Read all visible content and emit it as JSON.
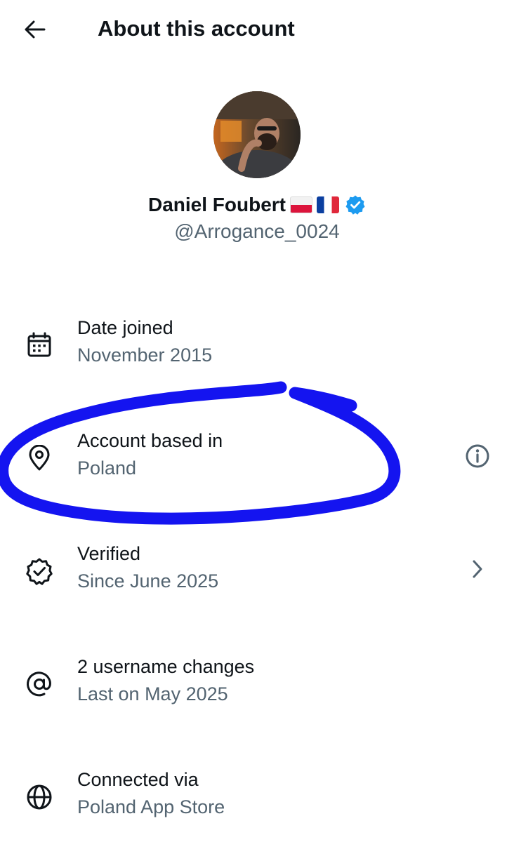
{
  "header": {
    "title": "About this account",
    "back_icon": "arrow-left-icon"
  },
  "profile": {
    "display_name": "Daniel Foubert",
    "flags": [
      "poland-flag",
      "france-flag"
    ],
    "verified_badge_color": "#1d9bf0",
    "handle": "@Arrogance_0024"
  },
  "rows": [
    {
      "icon": "calendar-icon",
      "label": "Date joined",
      "value": "November 2015",
      "action": null
    },
    {
      "icon": "location-pin-icon",
      "label": "Account based in",
      "value": "Poland",
      "action": "info-icon"
    },
    {
      "icon": "verified-check-icon",
      "label": "Verified",
      "value": "Since June 2025",
      "action": "chevron-right-icon"
    },
    {
      "icon": "at-sign-icon",
      "label": "2 username changes",
      "value": "Last on May 2025",
      "action": null
    },
    {
      "icon": "globe-icon",
      "label": "Connected via",
      "value": "Poland App Store",
      "action": null
    }
  ],
  "annotation": {
    "type": "hand-drawn-circle",
    "color": "#1414f0"
  },
  "colors": {
    "primary_text": "#0f1419",
    "secondary_text": "#536471",
    "background": "#ffffff"
  }
}
